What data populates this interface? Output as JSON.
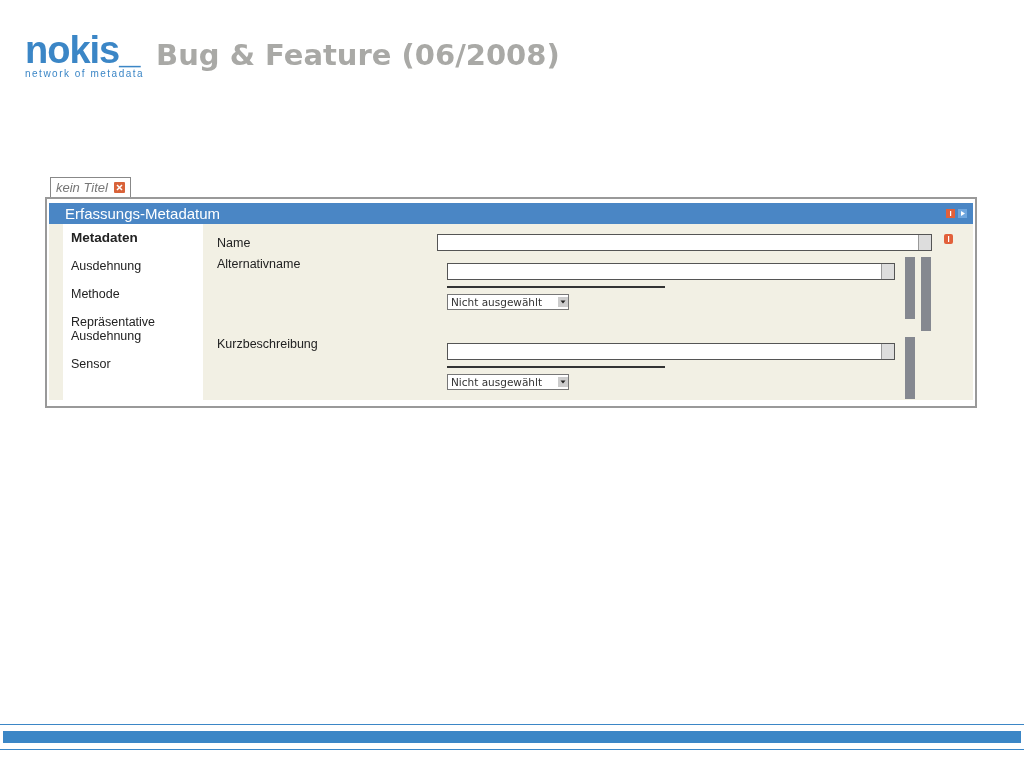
{
  "header": {
    "logo": "nokis_",
    "tagline": "network of metadata",
    "title": "Bug & Feature (06/2008)"
  },
  "tab": {
    "label": "kein Titel"
  },
  "panel": {
    "title": "Erfassungs-Metadatum"
  },
  "sidebar": {
    "items": [
      {
        "label": "Metadaten",
        "selected": true
      },
      {
        "label": "Ausdehnung",
        "selected": false
      },
      {
        "label": "Methode",
        "selected": false
      },
      {
        "label": "Repräsentative Ausdehnung",
        "selected": false
      },
      {
        "label": "Sensor",
        "selected": false
      }
    ]
  },
  "fields": [
    {
      "kind": "text",
      "label": "Name"
    },
    {
      "kind": "group",
      "label": "Alternativname",
      "select": "Nicht ausgewählt"
    },
    {
      "kind": "group",
      "label": "Kurzbeschreibung",
      "select": "Nicht ausgewählt"
    }
  ]
}
